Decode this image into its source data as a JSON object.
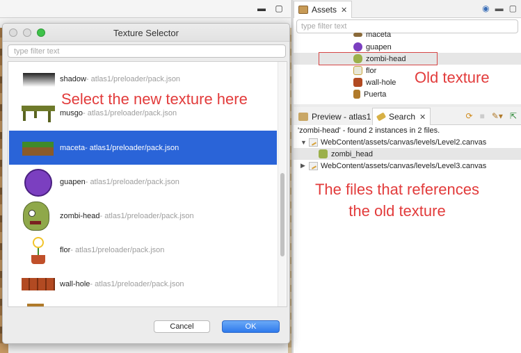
{
  "colors": {
    "accent": "#2a64d8",
    "annotation": "#e23b3b",
    "ok_button": "#2f79ec"
  },
  "assets_panel": {
    "tab_label": "Assets",
    "filter_placeholder": "type filter text",
    "items": [
      {
        "label": "maceta",
        "icon": "maceta-icon"
      },
      {
        "label": "guapen",
        "icon": "guapen-icon"
      },
      {
        "label": "zombi-head",
        "icon": "zombi-head-icon"
      },
      {
        "label": "flor",
        "icon": "flor-icon"
      },
      {
        "label": "wall-hole",
        "icon": "wall-hole-icon"
      },
      {
        "label": "Puerta",
        "icon": "puerta-icon"
      }
    ],
    "selected": "zombi-head"
  },
  "search_panel": {
    "tab_preview": "Preview - atlas1",
    "tab_search": "Search",
    "summary": "'zombi-head' - found 2 instances in 2 files.",
    "results": [
      {
        "file": "WebContent/assets/canvas/levels/Level2.canvas",
        "expanded": true,
        "child": "zombi_head"
      },
      {
        "file": "WebContent/assets/canvas/levels/Level3.canvas",
        "expanded": false
      }
    ]
  },
  "dialog": {
    "title": "Texture Selector",
    "filter_placeholder": "type filter text",
    "items": [
      {
        "name": "shadow",
        "path": " - atlas1/preloader/pack.json"
      },
      {
        "name": "musgo",
        "path": " - atlas1/preloader/pack.json"
      },
      {
        "name": "maceta",
        "path": " - atlas1/preloader/pack.json"
      },
      {
        "name": "guapen",
        "path": " - atlas1/preloader/pack.json"
      },
      {
        "name": "zombi-head",
        "path": " - atlas1/preloader/pack.json"
      },
      {
        "name": "flor",
        "path": " - atlas1/preloader/pack.json"
      },
      {
        "name": "wall-hole",
        "path": " - atlas1/preloader/pack.json"
      }
    ],
    "selected": "maceta",
    "cancel_label": "Cancel",
    "ok_label": "OK"
  },
  "annotations": {
    "select": "Select the new texture here",
    "old": "Old texture",
    "files_line1": "The files that references",
    "files_line2": "the old texture"
  }
}
